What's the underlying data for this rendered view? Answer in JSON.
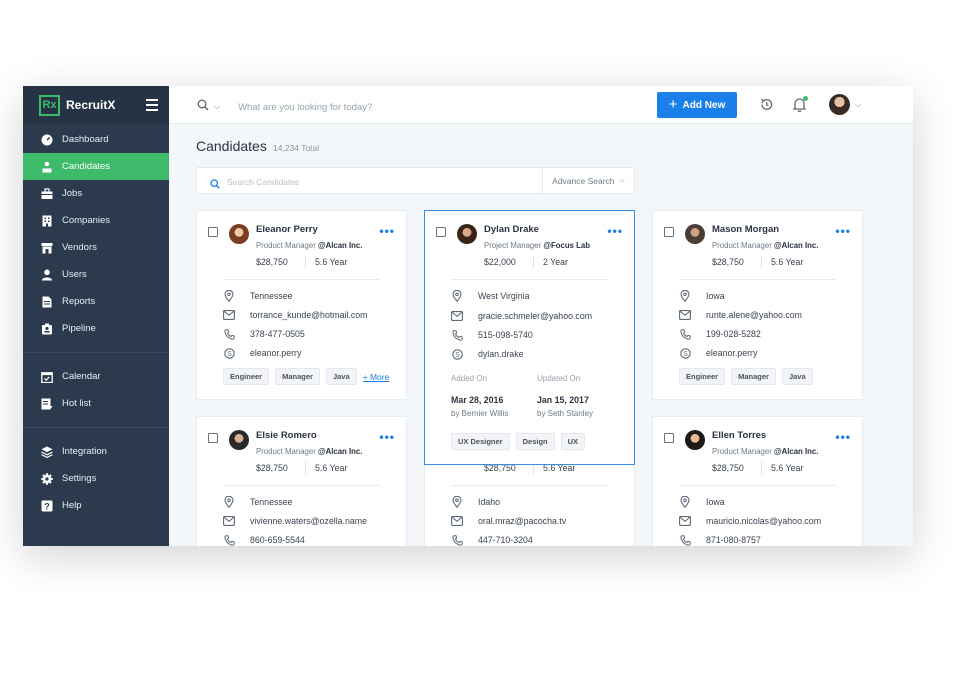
{
  "app": {
    "logo_text": "Rx",
    "name": "RecruitX"
  },
  "sidebar": {
    "items": [
      {
        "label": "Dashboard",
        "icon": "dashboard-icon"
      },
      {
        "label": "Candidates",
        "icon": "candidates-icon",
        "active": true
      },
      {
        "label": "Jobs",
        "icon": "briefcase-icon"
      },
      {
        "label": "Companies",
        "icon": "building-icon"
      },
      {
        "label": "Vendors",
        "icon": "store-icon"
      },
      {
        "label": "Users",
        "icon": "user-icon"
      },
      {
        "label": "Reports",
        "icon": "report-icon"
      },
      {
        "label": "Pipeline",
        "icon": "pipeline-icon"
      },
      {
        "label": "Calendar",
        "icon": "calendar-icon"
      },
      {
        "label": "Hot list",
        "icon": "hotlist-icon"
      },
      {
        "label": "Integration",
        "icon": "layers-icon"
      },
      {
        "label": "Settings",
        "icon": "gear-icon"
      },
      {
        "label": "Help",
        "icon": "help-icon"
      }
    ]
  },
  "topbar": {
    "search_placeholder": "What are you looking for today?",
    "add_button": "Add New"
  },
  "page": {
    "title": "Candidates",
    "total": "14,234 Total",
    "search_placeholder": "Search Candidates",
    "advance_search": "Advance Search"
  },
  "colors": {
    "accent_green": "#3dbb6b",
    "primary_blue": "#1a7fe8",
    "sidebar_bg": "#2c3a4e"
  },
  "cards": [
    {
      "name": "Eleanor Perry",
      "role": "Product Manager",
      "company": "@Alcan Inc.",
      "salary": "$28,750",
      "experience": "5.6 Year",
      "location": "Tennessee",
      "email": "torrance_kunde@hotmail.com",
      "phone": "378-477-0505",
      "skype": "eleanor.perry",
      "tags": [
        "Engineer",
        "Manager",
        "Java"
      ],
      "more": "+ More"
    },
    {
      "name": "Dylan Drake",
      "role": "Project Manager",
      "company": "@Focus Lab",
      "salary": "$22,000",
      "experience": "2 Year",
      "location": "West Virginia",
      "email": "gracie.schmeler@yahoo.com",
      "phone": "515-098-5740",
      "skype": "dylan.drake",
      "added_label": "Added On",
      "added_date": "Mar 28, 2016",
      "added_by": "by Bernier Willis",
      "updated_label": "Updated On",
      "updated_date": "Jan 15, 2017",
      "updated_by": "by Seth Stanley",
      "tags": [
        "UX Designer",
        "Design",
        "UX"
      ]
    },
    {
      "name": "Mason Morgan",
      "role": "Product Manager",
      "company": "@Alcan Inc.",
      "salary": "$28,750",
      "experience": "5.6 Year",
      "location": "Iowa",
      "email": "runte.alene@yahoo.com",
      "phone": "199-028-5282",
      "skype": "eleanor.perry",
      "tags": [
        "Engineer",
        "Manager",
        "Java"
      ]
    },
    {
      "name": "Elsie Romero",
      "role": "Product Manager",
      "company": "@Alcan Inc.",
      "salary": "$28,750",
      "experience": "5.6 Year",
      "location": "Tennessee",
      "email": "vivienne.waters@ozella.name",
      "phone": "860-659-5544"
    },
    {
      "salary": "$28,750",
      "experience": "5.6 Year",
      "location": "Idaho",
      "email": "oral.mraz@pacocha.tv",
      "phone": "447-710-3204"
    },
    {
      "name": "Ellen Torres",
      "role": "Product Manager",
      "company": "@Alcan Inc.",
      "salary": "$28,750",
      "experience": "5.6 Year",
      "location": "Iowa",
      "email": "mauricio.nicolas@yahoo.com",
      "phone": "871-080-8757"
    }
  ]
}
